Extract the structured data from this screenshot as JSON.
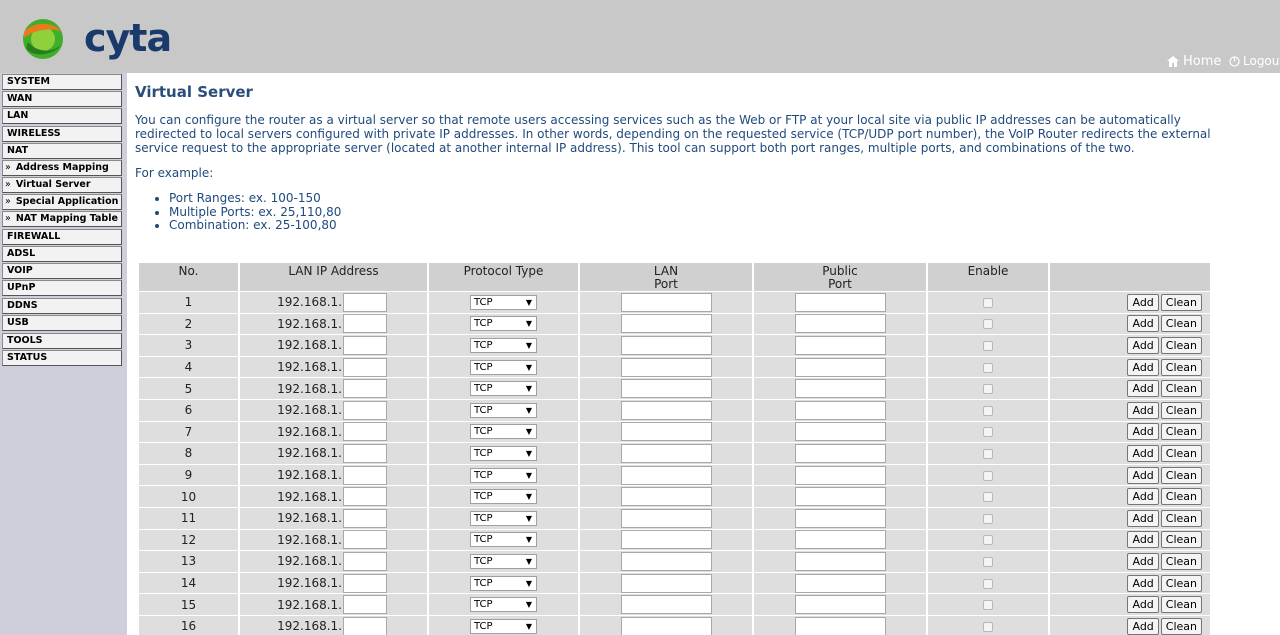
{
  "brand": {
    "logo_text": "cyta"
  },
  "top_links": {
    "home": "Home",
    "logout": "Logout"
  },
  "sidebar": {
    "items": [
      {
        "label": "SYSTEM",
        "sub": false
      },
      {
        "label": "WAN",
        "sub": false
      },
      {
        "label": "LAN",
        "sub": false
      },
      {
        "label": "WIRELESS",
        "sub": false
      },
      {
        "label": "NAT",
        "sub": false
      },
      {
        "label": "Address Mapping",
        "sub": true
      },
      {
        "label": "Virtual Server",
        "sub": true
      },
      {
        "label": "Special Application",
        "sub": true
      },
      {
        "label": "NAT Mapping Table",
        "sub": true
      },
      {
        "label": "FIREWALL",
        "sub": false
      },
      {
        "label": "ADSL",
        "sub": false
      },
      {
        "label": "VOIP",
        "sub": false
      },
      {
        "label": "UPnP",
        "sub": false
      },
      {
        "label": "DDNS",
        "sub": false
      },
      {
        "label": "USB",
        "sub": false
      },
      {
        "label": "TOOLS",
        "sub": false
      },
      {
        "label": "STATUS",
        "sub": false
      }
    ],
    "sub_arrow": "»"
  },
  "main": {
    "title": "Virtual Server",
    "description": "You can configure the router as a virtual server so that remote users accessing services such as the Web or FTP at your local site via public IP addresses can be automatically redirected to local servers configured with private IP addresses. In other words, depending on the requested service (TCP/UDP port number), the VoIP Router redirects the external service request to the appropriate server (located at another internal IP address). This tool can support both port ranges, multiple ports, and combinations of the two.",
    "example_label": "For example:",
    "examples": [
      "Port Ranges: ex. 100-150",
      "Multiple Ports: ex. 25,110,80",
      "Combination: ex. 25-100,80"
    ]
  },
  "table": {
    "headers": {
      "no": "No.",
      "lan_ip": "LAN IP Address",
      "protocol": "Protocol Type",
      "lan_port_1": "LAN",
      "lan_port_2": "Port",
      "public_port_1": "Public",
      "public_port_2": "Port",
      "enable": "Enable"
    },
    "ip_prefix": "192.168.1.",
    "protocol_value": "TCP",
    "add_label": "Add",
    "clean_label": "Clean",
    "rows": [
      "1",
      "2",
      "3",
      "4",
      "5",
      "6",
      "7",
      "8",
      "9",
      "10",
      "11",
      "12",
      "13",
      "14",
      "15",
      "16"
    ]
  },
  "colors": {
    "header_bg": "#c8c8c8",
    "sidebar_bg": "#cfcfdc",
    "title": "#2a4d7a",
    "logo_green": "#3fae2a",
    "logo_navy": "#1a3a6b"
  }
}
